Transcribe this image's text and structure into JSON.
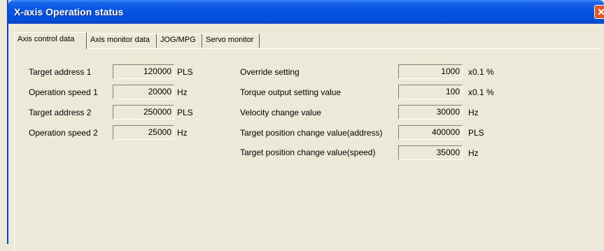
{
  "window": {
    "title": "X-axis Operation status",
    "close_glyph": "✕"
  },
  "tabs": [
    {
      "label": "Axis control data",
      "active": true
    },
    {
      "label": "Axis monitor data",
      "active": false
    },
    {
      "label": "JOG/MPG",
      "active": false
    },
    {
      "label": "Servo monitor",
      "active": false
    }
  ],
  "left_fields": [
    {
      "label": "Target address 1",
      "value": "120000",
      "unit": "PLS"
    },
    {
      "label": "Operation speed 1",
      "value": "20000",
      "unit": "Hz"
    },
    {
      "label": "Target address 2",
      "value": "250000",
      "unit": "PLS"
    },
    {
      "label": "Operation speed 2",
      "value": "25000",
      "unit": "Hz"
    }
  ],
  "right_fields": [
    {
      "label": "Override setting",
      "value": "1000",
      "unit": "x0.1 %"
    },
    {
      "label": "Torque output setting value",
      "value": "100",
      "unit": "x0.1 %"
    },
    {
      "label": "Velocity change value",
      "value": "30000",
      "unit": "Hz"
    },
    {
      "label": "Target position change value(address)",
      "value": "400000",
      "unit": "PLS"
    },
    {
      "label": "Target position change value(speed)",
      "value": "35000",
      "unit": "Hz"
    }
  ]
}
